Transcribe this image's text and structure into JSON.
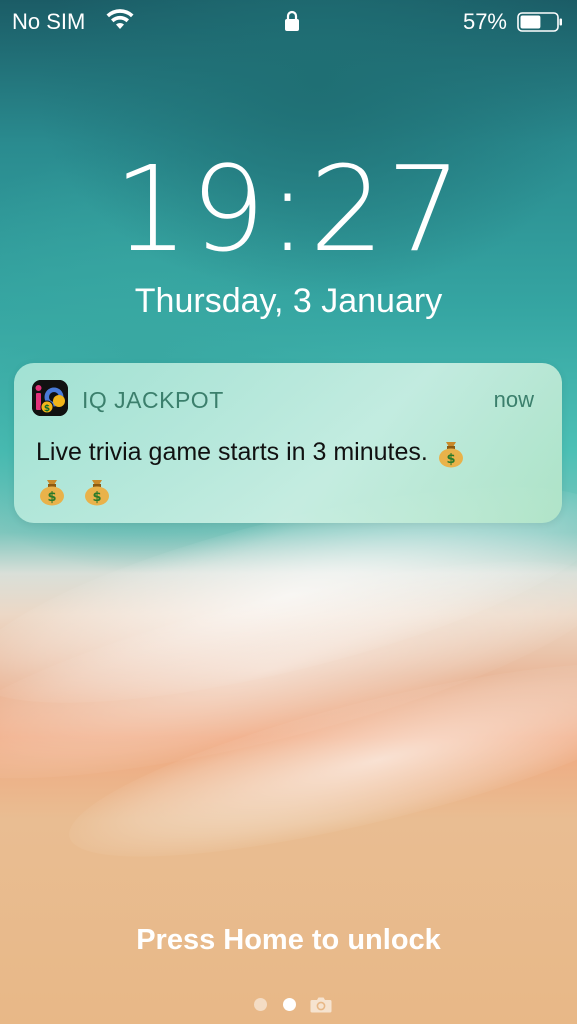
{
  "status_bar": {
    "carrier": "No SIM",
    "battery_percent": "57%",
    "battery_level": 0.57,
    "icons": [
      "wifi-icon",
      "lock-icon",
      "battery-icon"
    ]
  },
  "lock_screen": {
    "time": "19:27",
    "date": "Thursday, 3 January",
    "unlock_hint": "Press Home to unlock",
    "page_indicator": {
      "pages": 2,
      "active": 1,
      "extra": "camera-icon"
    }
  },
  "notification": {
    "app_name": "IQ JACKPOT",
    "time": "now",
    "message": "Live trivia game starts in 3 minutes.",
    "emoji": [
      "money-bag",
      "money-bag",
      "money-bag"
    ],
    "app_icon": "iq-jackpot-app-icon"
  },
  "colors": {
    "notification_accent": "#3b7f6c",
    "text_white": "#ffffff"
  }
}
